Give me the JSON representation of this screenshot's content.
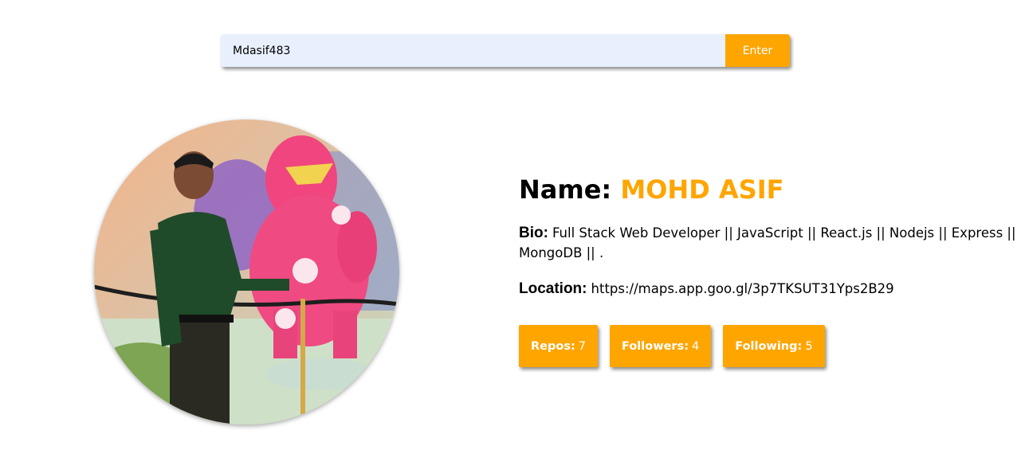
{
  "search": {
    "value": "Mdasif483",
    "button_label": "Enter"
  },
  "profile": {
    "name_label": "Name:",
    "name": "MOHD ASIF",
    "bio_label": "Bio:",
    "bio": "Full Stack Web Developer || JavaScript || React.js || Nodejs || Express || MongoDB || .",
    "location_label": "Location:",
    "location": "https://maps.app.goo.gl/3p7TKSUT31Yps2B29"
  },
  "stats": [
    {
      "label": "Repos:",
      "value": "7"
    },
    {
      "label": "Followers:",
      "value": "4"
    },
    {
      "label": "Following:",
      "value": "5"
    }
  ],
  "colors": {
    "accent": "#ffa500",
    "input_bg": "#e8f0fe"
  }
}
